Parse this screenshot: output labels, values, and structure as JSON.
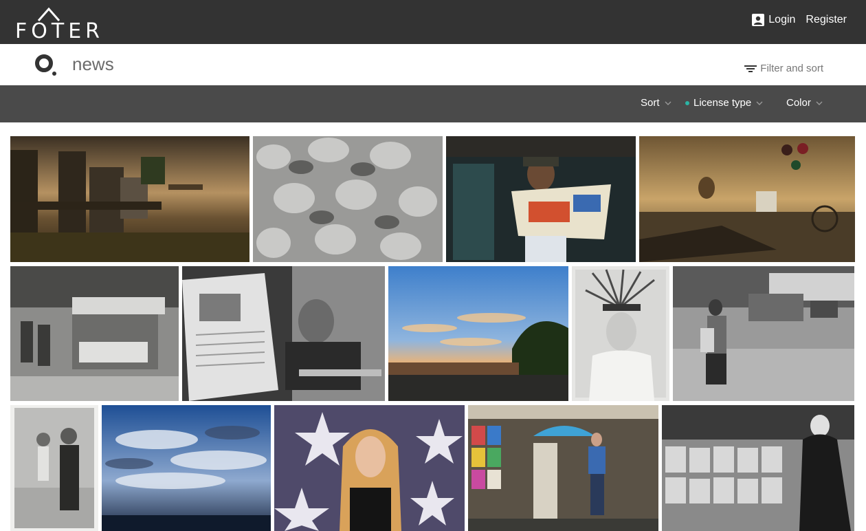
{
  "header": {
    "logo_text": "FOTER",
    "login_label": "Login",
    "register_label": "Register"
  },
  "search": {
    "query": "news",
    "filter_label": "Filter and sort"
  },
  "filters": {
    "sort_label": "Sort",
    "license_label": "License type",
    "color_label": "Color",
    "license_active_color": "#2bb5a5"
  },
  "colors": {
    "topbar": "#333333",
    "filterbar": "#4a4a4a"
  },
  "photos": [
    {
      "name": "mailboxes-at-sunset"
    },
    {
      "name": "egg-carton-texture"
    },
    {
      "name": "man-reading-newspaper"
    },
    {
      "name": "scarecrow-balloons-scene"
    },
    {
      "name": "vintage-newsstand-kiosk"
    },
    {
      "name": "man-reading-newspaper-bw"
    },
    {
      "name": "sunset-sky-parking-lot"
    },
    {
      "name": "woman-feather-headdress"
    },
    {
      "name": "street-walker-bw"
    },
    {
      "name": "vintage-children-photo"
    },
    {
      "name": "blue-cloudy-sky"
    },
    {
      "name": "woman-speaker-stars"
    },
    {
      "name": "colorful-newsstand"
    },
    {
      "name": "newsstand-magazines-bw"
    }
  ]
}
